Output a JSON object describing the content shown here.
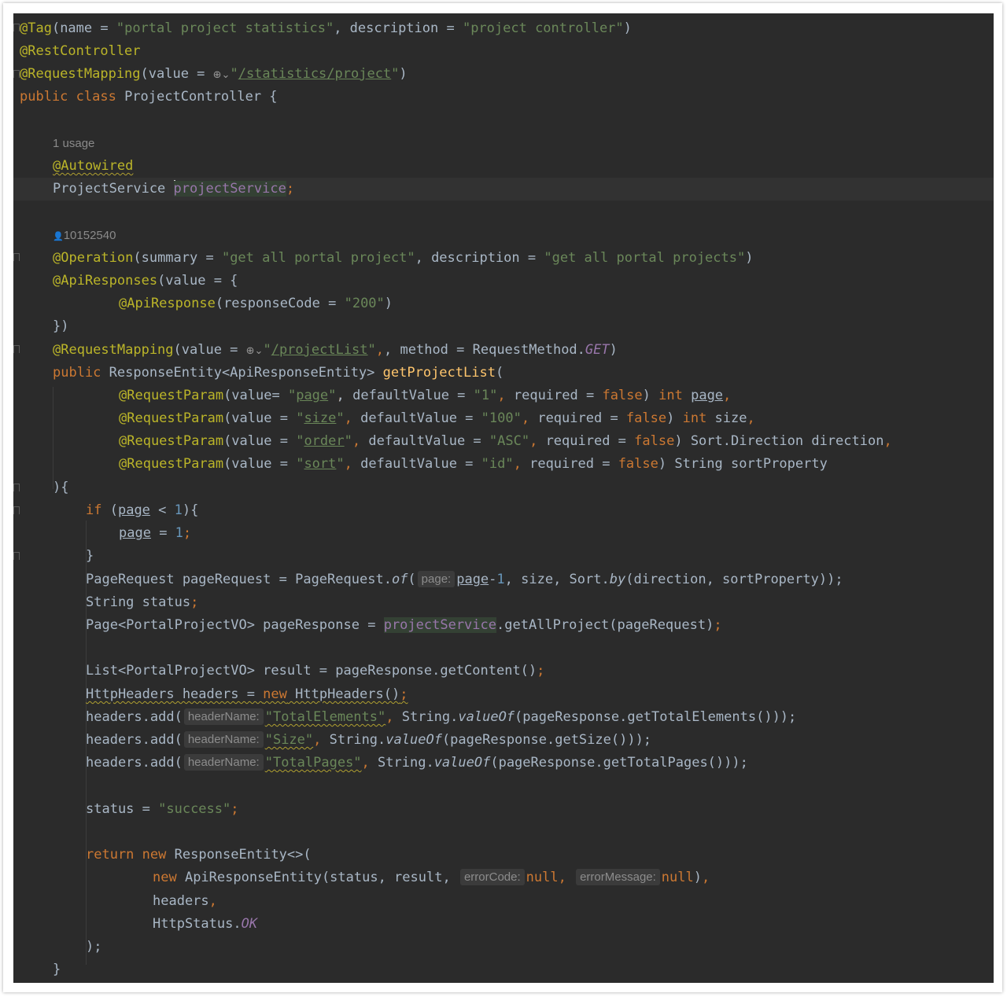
{
  "code": {
    "tag_annotation": "@Tag",
    "tag_args_1": "(name = ",
    "tag_name": "\"portal project statistics\"",
    "tag_args_2": ", description = ",
    "tag_desc": "\"project controller\"",
    "tag_close": ")",
    "rest_controller": "@RestController",
    "request_mapping": "@RequestMapping",
    "rm_args": "(value = ",
    "rm_url": "/statistics/project",
    "public_class": "public class",
    "class_name": " ProjectController {",
    "usage_hint": "1 usage",
    "autowired": "@Autowired",
    "field_type": "ProjectService ",
    "field_name_p": "p",
    "field_name_rest": "rojectService",
    "semicolon": ";",
    "author_icon": "user-icon",
    "author": "10152540",
    "operation": "@Operation",
    "op_args_1": "(summary = ",
    "op_summary": "\"get all portal project\"",
    "op_args_2": ", description = ",
    "op_desc": "\"get all portal projects\"",
    "op_close": ")",
    "api_responses": "@ApiResponses",
    "ar_args": "(value = {",
    "api_response": "@ApiResponse",
    "ar_code_args": "(responseCode = ",
    "ar_code": "\"200\"",
    "ar_close": ")",
    "ar_end": "})",
    "rm2_args": "(value = ",
    "rm2_url": "/projectList",
    "rm2_method": ", method = RequestMethod.",
    "rm2_get": "GET",
    "public": "public",
    "ret_type": " ResponseEntity<ApiResponseEntity> ",
    "method_name": "getProjectList",
    "open_paren": "(",
    "request_param": "@RequestParam",
    "rp1_a": "(value= ",
    "rp1_name": "page",
    "rp1_b": ", defaultValue = ",
    "rp1_def": "\"1\"",
    "rp_req": ", required = ",
    "false": "false",
    "int": "int",
    "rp1_var": "page",
    "comma": ",",
    "rp_a": "(value = ",
    "rp2_name": "size",
    "rp2_def": "\"100\"",
    "rp2_var": " size",
    "rp3_name": "order",
    "rp3_def": "\"ASC\"",
    "rp3_type": ") Sort.Direction direction",
    "rp4_name": "sort",
    "rp4_def": "\"id\"",
    "rp4_type": ") String sortProperty",
    "close_open_brace": "){",
    "if": "if",
    "if_a": " (",
    "page": "page",
    "if_b": " < ",
    "one": "1",
    "if_c": "){",
    "assign": " = ",
    "close_brace": "}",
    "pr_a": "PageRequest pageRequest = PageRequest.",
    "pr_of": "of",
    "hint_page": "page:",
    "pr_minus": "-",
    "pr_b": ", size, Sort.",
    "pr_by": "by",
    "pr_c": "(direction, sortProperty));",
    "string_status": "String status",
    "page_resp_a": "Page<PortalProjectVO> pageResponse = ",
    "project_service": "projectService",
    "page_resp_b": ".getAllProject(pageRequest)",
    "list_line": "List<PortalProjectVO> result = pageResponse.getContent()",
    "headers_line_a": "HttpHeaders headers = ",
    "new": "new",
    "headers_line_b": " HttpHeaders()",
    "headers_add": "headers.add(",
    "hint_header_name": "headerName:",
    "h1_key": "\"TotalElements\"",
    "h_string": " String.",
    "value_of": "valueOf",
    "h1_val": "(pageResponse.getTotalElements()));",
    "h2_key": "\"Size\"",
    "h2_val": "(pageResponse.getSize()));",
    "h3_key": "\"TotalPages\"",
    "h3_val": "(pageResponse.getTotalPages()));",
    "status_a": "status = ",
    "status_val": "\"success\"",
    "return": "return",
    "ret_b": " ResponseEntity<>(",
    "api_entity": " ApiResponseEntity(status, result, ",
    "hint_error_code": "errorCode:",
    "null": "null",
    "hint_error_message": "errorMessage:",
    "entity_close": ")",
    "headers_arg": "headers",
    "http_status": "HttpStatus.",
    "ok": "OK",
    "close_paren_semi": ");"
  }
}
